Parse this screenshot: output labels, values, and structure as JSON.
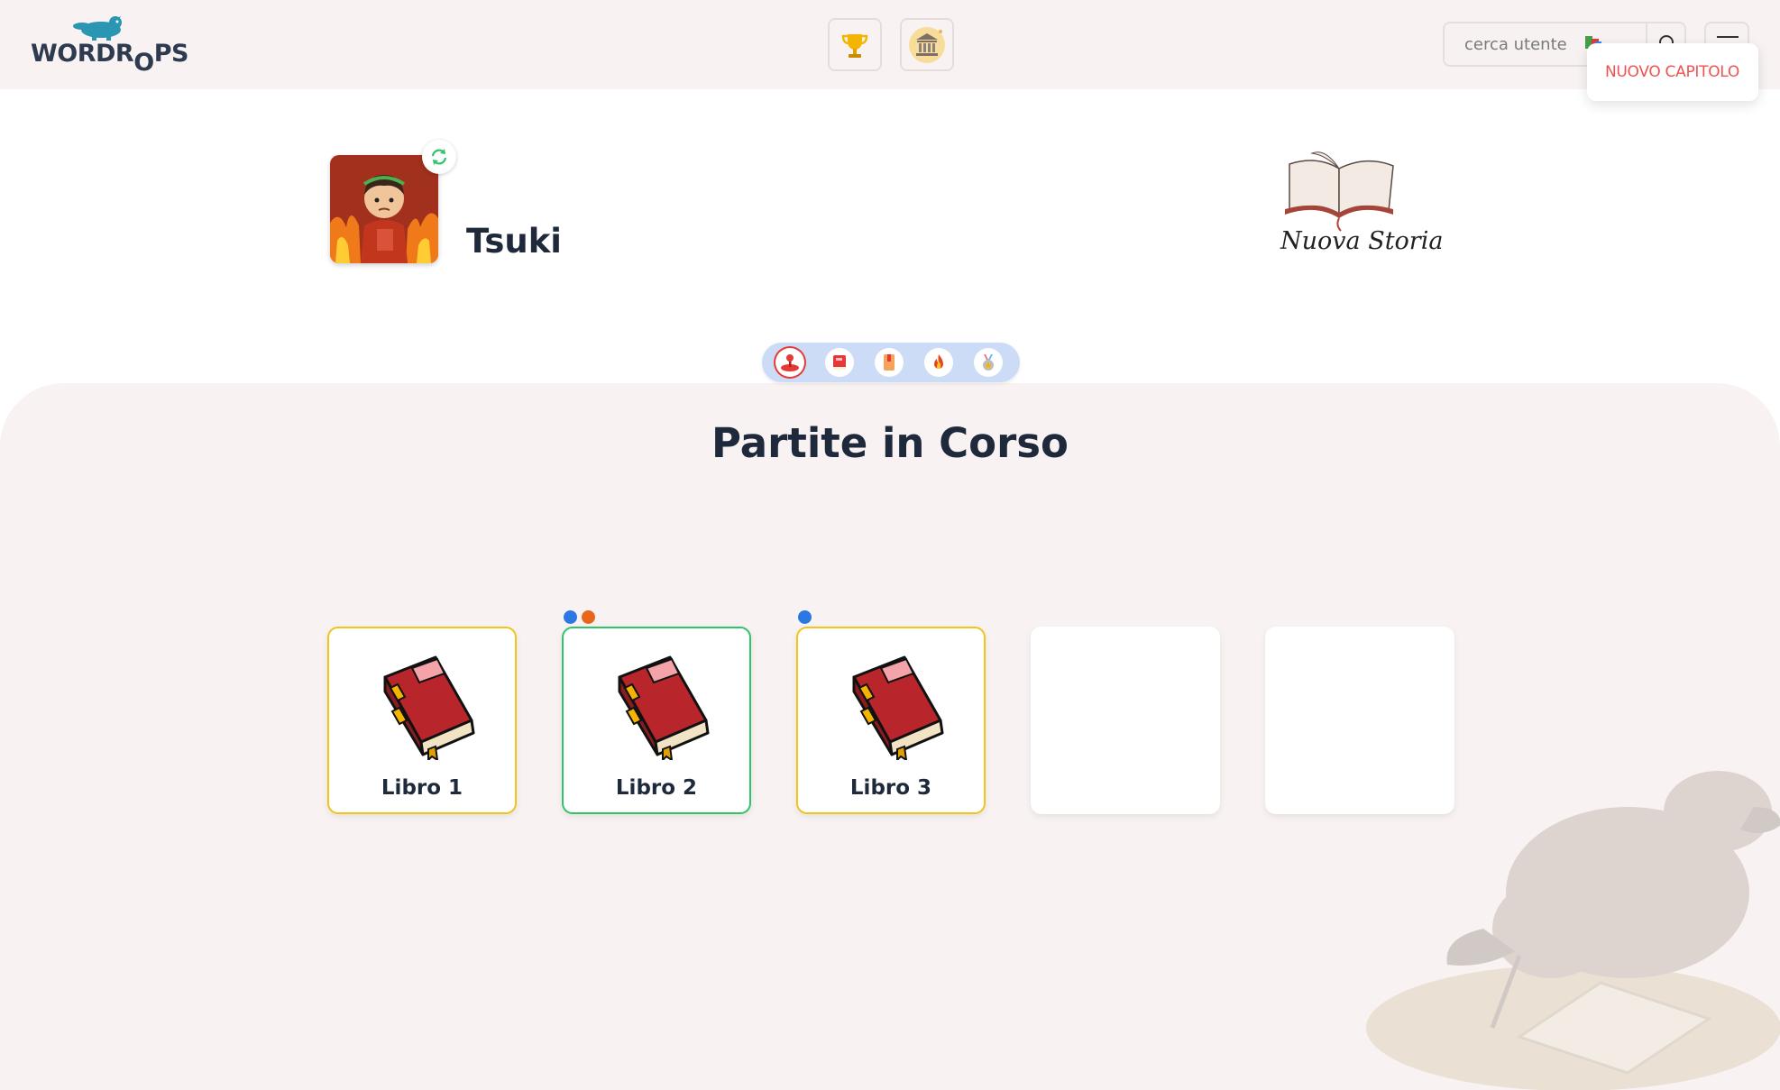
{
  "header": {
    "logo_text_pre": "WORDR",
    "logo_text_o": "O",
    "logo_text_post": "PS",
    "trophy_icon": "trophy-icon",
    "museum_icon": "museum-icon",
    "search_placeholder": "cerca utente",
    "popup_label": "NUOVO CAPITOLO"
  },
  "profile": {
    "username": "Tsuki",
    "new_story_label": "Nuova Storia"
  },
  "tabs": [
    {
      "icon": "joystick-icon",
      "active": true
    },
    {
      "icon": "red-book-icon"
    },
    {
      "icon": "orange-book-icon"
    },
    {
      "icon": "fire-icon"
    },
    {
      "icon": "medal-icon"
    }
  ],
  "main": {
    "title": "Partite in Corso",
    "cards": [
      {
        "label": "Libro 1",
        "border": "yellow",
        "dots": []
      },
      {
        "label": "Libro 2",
        "border": "green",
        "dots": [
          "#2b78e4",
          "#e8671a"
        ]
      },
      {
        "label": "Libro 3",
        "border": "yellow",
        "dots": [
          "#2b78e4"
        ]
      },
      {
        "label": "",
        "border": "none",
        "dots": []
      },
      {
        "label": "",
        "border": "none",
        "dots": []
      }
    ]
  },
  "colors": {
    "accent_red": "#ef5350",
    "card_yellow": "#f0c419",
    "card_green": "#2fc46a",
    "tabs_bg": "#cddcf6",
    "background": "#f8f3f2"
  }
}
